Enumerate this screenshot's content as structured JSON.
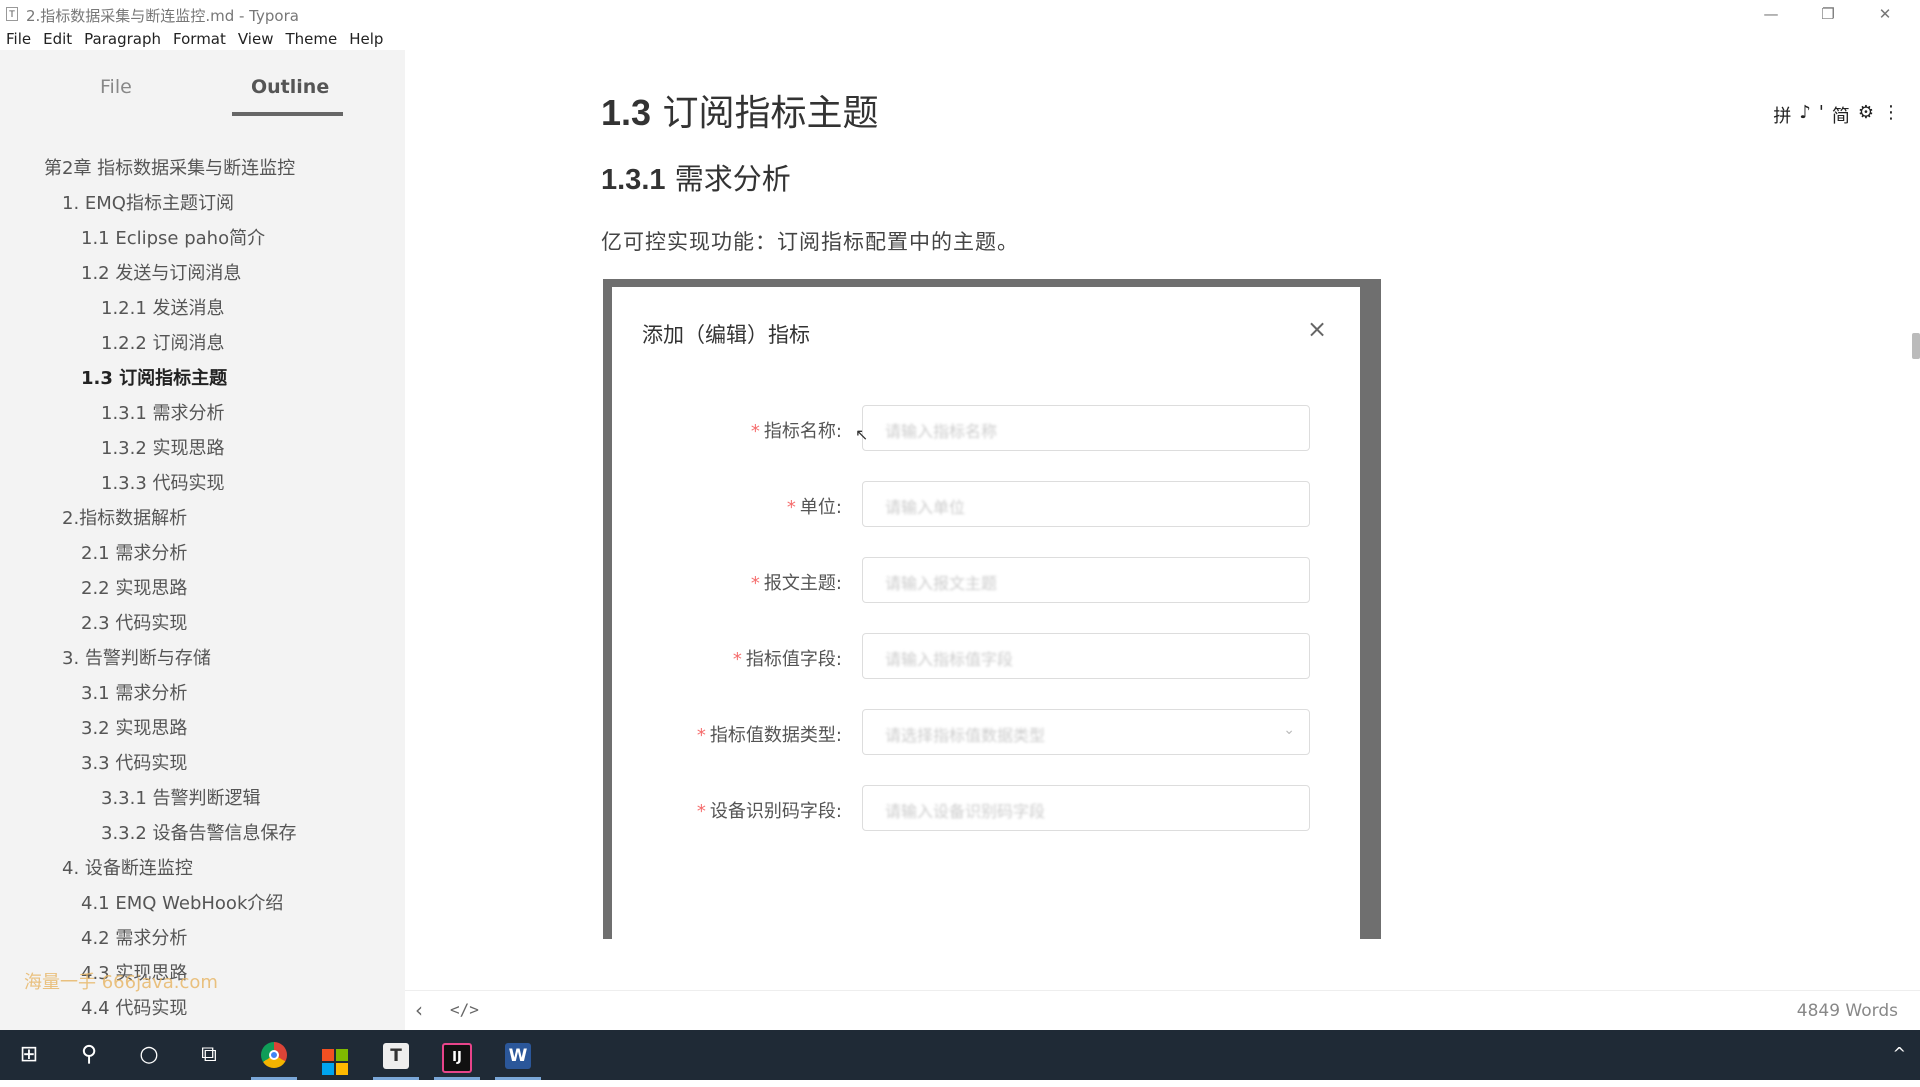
{
  "window": {
    "title": "2.指标数据采集与断连监控.md - Typora",
    "app_icon": "T",
    "minimize": "—",
    "maximize": "❐",
    "close": "✕"
  },
  "menu": [
    "File",
    "Edit",
    "Paragraph",
    "Format",
    "View",
    "Theme",
    "Help"
  ],
  "sidebar": {
    "tabs": {
      "file": "File",
      "outline": "Outline"
    },
    "outline": [
      {
        "label": "第2章 指标数据采集与断连监控",
        "level": 0
      },
      {
        "label": "1. EMQ指标主题订阅",
        "level": 1
      },
      {
        "label": "1.1 Eclipse paho简介",
        "level": 2
      },
      {
        "label": "1.2 发送与订阅消息",
        "level": 2
      },
      {
        "label": "1.2.1 发送消息",
        "level": 3
      },
      {
        "label": "1.2.2 订阅消息",
        "level": 3
      },
      {
        "label": "1.3 订阅指标主题",
        "level": 2,
        "active": true
      },
      {
        "label": "1.3.1 需求分析",
        "level": 3
      },
      {
        "label": "1.3.2 实现思路",
        "level": 3
      },
      {
        "label": "1.3.3 代码实现",
        "level": 3
      },
      {
        "label": "2.指标数据解析",
        "level": 1
      },
      {
        "label": "2.1 需求分析",
        "level": 2
      },
      {
        "label": "2.2 实现思路",
        "level": 2
      },
      {
        "label": "2.3 代码实现",
        "level": 2
      },
      {
        "label": "3. 告警判断与存储",
        "level": 1
      },
      {
        "label": "3.1 需求分析",
        "level": 2
      },
      {
        "label": "3.2 实现思路",
        "level": 2
      },
      {
        "label": "3.3 代码实现",
        "level": 2
      },
      {
        "label": "3.3.1 告警判断逻辑",
        "level": 3
      },
      {
        "label": "3.3.2 设备告警信息保存",
        "level": 3
      },
      {
        "label": "4. 设备断连监控",
        "level": 1
      },
      {
        "label": "4.1 EMQ WebHook介绍",
        "level": 2
      },
      {
        "label": "4.2 需求分析",
        "level": 2
      },
      {
        "label": "4.3 实现思路",
        "level": 2
      },
      {
        "label": "4.4 代码实现",
        "level": 2
      }
    ],
    "watermark": "海量一手 666java.com"
  },
  "editor": {
    "h1_num": "1.3",
    "h1_text": "订阅指标主题",
    "h2_num": "1.3.1",
    "h2_text": "需求分析",
    "paragraph": "亿可控实现功能：订阅指标配置中的主题。",
    "toolbar_icons": [
      "拼",
      "♪",
      "'",
      "简",
      "⚙",
      "⋮"
    ]
  },
  "dialog": {
    "title": "添加（编辑）指标",
    "close": "×",
    "fields": [
      {
        "label": "指标名称:",
        "placeholder": "请输入指标名称",
        "type": "input"
      },
      {
        "label": "单位:",
        "placeholder": "请输入单位",
        "type": "input"
      },
      {
        "label": "报文主题:",
        "placeholder": "请输入报文主题",
        "type": "input"
      },
      {
        "label": "指标值字段:",
        "placeholder": "请输入指标值字段",
        "type": "input"
      },
      {
        "label": "指标值数据类型:",
        "placeholder": "请选择指标值数据类型",
        "type": "select"
      },
      {
        "label": "设备识别码字段:",
        "placeholder": "请输入设备识别码字段",
        "type": "input"
      }
    ]
  },
  "status": {
    "back": "‹",
    "source_toggle": "</>",
    "word_count": "4849 Words"
  },
  "taskbar": {
    "start": "⊞",
    "search": "⚲",
    "cortana": "○",
    "task_view": "⧉",
    "typora": "T",
    "idea": "IJ",
    "word": "W",
    "tray_chevron": "^"
  }
}
